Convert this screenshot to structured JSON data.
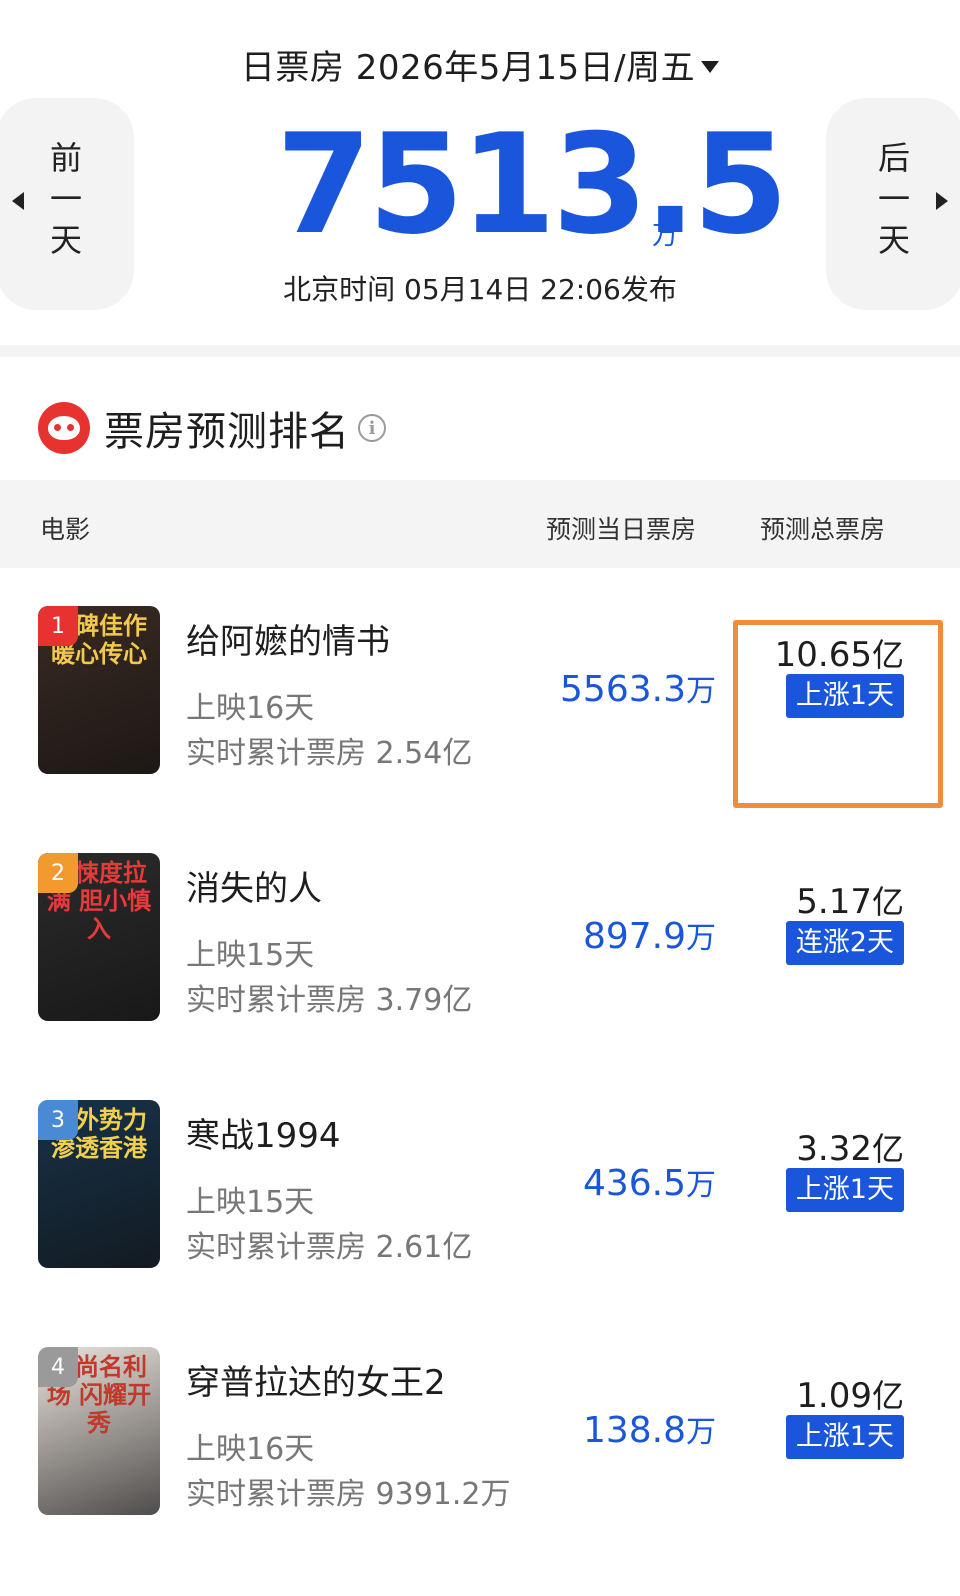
{
  "header": {
    "date_label": "日票房 2026年5月15日/周五",
    "total_value": "7513.5",
    "total_unit": "万",
    "publish_info": "北京时间  05月14日  22:06发布",
    "prev_day": "前\n一\n天",
    "next_day": "后\n一\n天"
  },
  "section": {
    "title": "票房预测排名",
    "info_glyph": "i"
  },
  "table": {
    "col_movie": "电影",
    "col_day": "预测当日票房",
    "col_total": "预测总票房"
  },
  "movies": [
    {
      "rank": "1",
      "title": "给阿嬷的情书",
      "days": "上映16天",
      "cumulative": "实时累计票房 2.54亿",
      "pred_day": "5563.3",
      "pred_day_unit": "万",
      "pred_total": "10.65",
      "pred_total_unit": "亿",
      "trend": "上涨1天",
      "poster_text": "口碑佳作 暖心传心",
      "rank_color": "#e8322f",
      "poster_bg": "#3a2a22",
      "poster_fg": "#f2c94c"
    },
    {
      "rank": "2",
      "title": "消失的人",
      "days": "上映15天",
      "cumulative": "实时累计票房 3.79亿",
      "pred_day": "897.9",
      "pred_day_unit": "万",
      "pred_total": "5.17",
      "pred_total_unit": "亿",
      "trend": "连涨2天",
      "poster_text": "惊悚度拉满 胆小慎入",
      "rank_color": "#f29a2e",
      "poster_bg": "#2b2b2b",
      "poster_fg": "#e63a3a"
    },
    {
      "rank": "3",
      "title": "寒战1994",
      "days": "上映15天",
      "cumulative": "实时累计票房 2.61亿",
      "pred_day": "436.5",
      "pred_day_unit": "万",
      "pred_total": "3.32",
      "pred_total_unit": "亿",
      "trend": "上涨1天",
      "poster_text": "境外势力 渗透香港",
      "rank_color": "#4a8ad4",
      "poster_bg": "#17324a",
      "poster_fg": "#f2d04c"
    },
    {
      "rank": "4",
      "title": "穿普拉达的女王2",
      "days": "上映16天",
      "cumulative": "实时累计票房 9391.2万",
      "pred_day": "138.8",
      "pred_day_unit": "万",
      "pred_total": "1.09",
      "pred_total_unit": "亿",
      "trend": "上涨1天",
      "poster_text": "时尚名利场 闪耀开秀",
      "rank_color": "#9a9a9a",
      "poster_bg": "#e9e2dc",
      "poster_fg": "#c0392b"
    }
  ],
  "colors": {
    "accent_blue": "#1a56db",
    "highlight_orange": "#f08c3a",
    "brand_red": "#e8322f"
  }
}
